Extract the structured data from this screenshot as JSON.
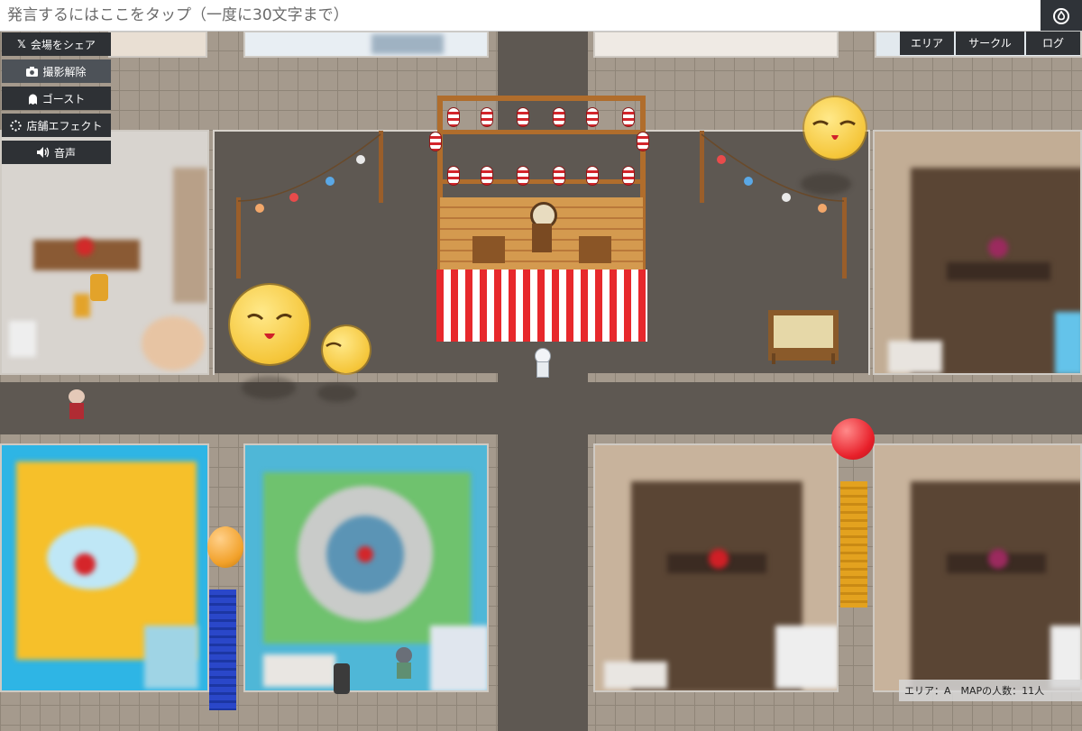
{
  "chat": {
    "placeholder": "発言するにはここをタップ（一度に30文字まで）",
    "icon": "flame-icon"
  },
  "left_menu": [
    {
      "key": "share",
      "icon": "x-logo-icon",
      "label": "会場をシェア"
    },
    {
      "key": "photo",
      "icon": "camera-icon",
      "label": "撮影解除",
      "active": true
    },
    {
      "key": "ghost",
      "icon": "ghost-icon",
      "label": "ゴースト"
    },
    {
      "key": "effect",
      "icon": "sparkle-spinner-icon",
      "label": "店舗エフェクト"
    },
    {
      "key": "voice",
      "icon": "speaker-icon",
      "label": "音声"
    }
  ],
  "right_menu": [
    {
      "key": "area",
      "label": "エリア"
    },
    {
      "key": "circle",
      "label": "サークル"
    },
    {
      "key": "log",
      "label": "ログ"
    }
  ],
  "status": {
    "text": "エリア：A　MAPの人数：11人",
    "area": "A",
    "people_count": 11
  },
  "colors": {
    "toolbar_bg": "#2e3135",
    "road": "#5e5852",
    "stage_stripe_red": "#e7282c",
    "balloon_red": "#e8202a",
    "balloon_orange": "#f2a12a",
    "smiley": "#f5c63a"
  }
}
